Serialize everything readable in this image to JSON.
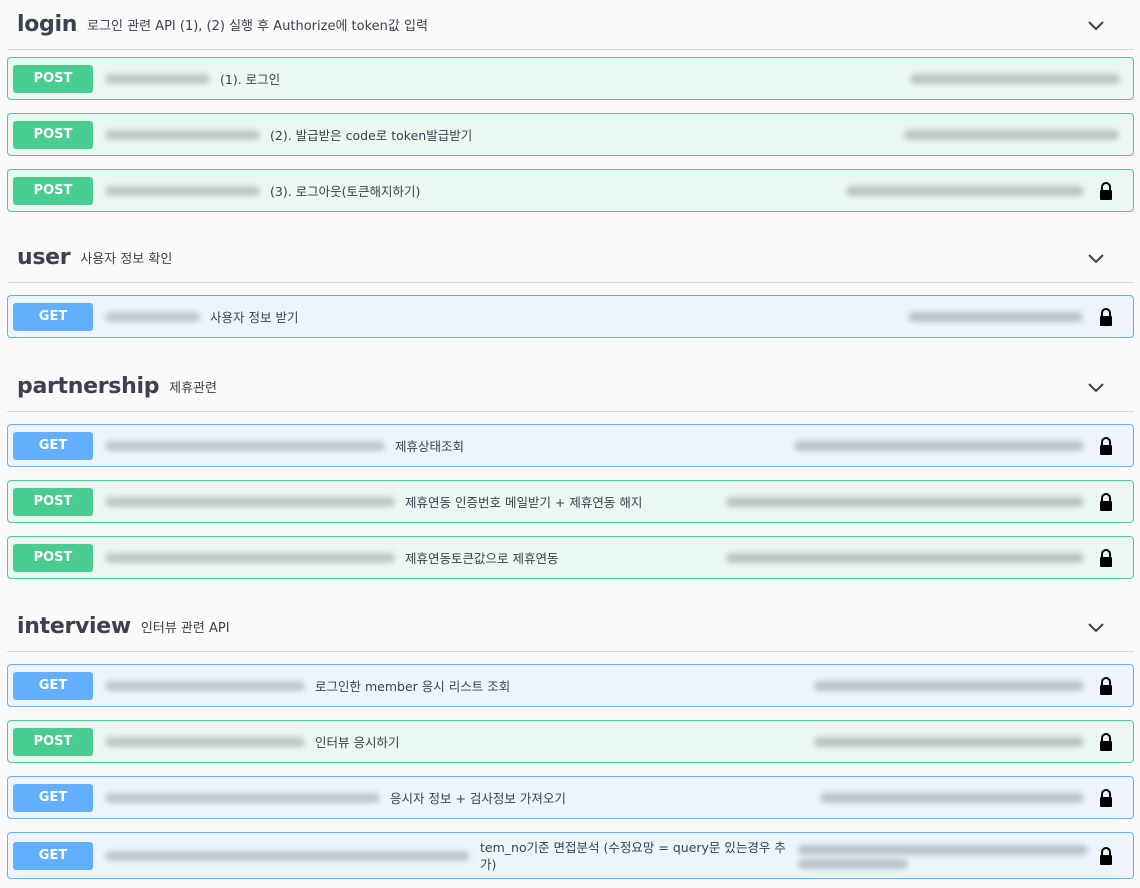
{
  "sections": [
    {
      "tag": "login",
      "description": "로그인 관련 API (1), (2) 실행 후 Authorize에 token값 입력",
      "operations": [
        {
          "method": "POST",
          "summary": "(1). 로그인",
          "locked": false
        },
        {
          "method": "POST",
          "summary": "(2). 발급받은 code로 token발급받기",
          "locked": false
        },
        {
          "method": "POST",
          "summary": "(3). 로그아웃(토큰해지하기)",
          "locked": true
        }
      ]
    },
    {
      "tag": "user",
      "description": "사용자 정보 확인",
      "operations": [
        {
          "method": "GET",
          "summary": "사용자 정보 받기",
          "locked": true
        }
      ]
    },
    {
      "tag": "partnership",
      "description": "제휴관련",
      "operations": [
        {
          "method": "GET",
          "summary": "제휴상태조회",
          "locked": true
        },
        {
          "method": "POST",
          "summary": "제휴연동 인증번호 메일받기 + 제휴연동 해지",
          "locked": true
        },
        {
          "method": "POST",
          "summary": "제휴연동토큰값으로 제휴연동",
          "locked": true
        }
      ]
    },
    {
      "tag": "interview",
      "description": "인터뷰 관련 API",
      "operations": [
        {
          "method": "GET",
          "summary": "로그인한 member 응시 리스트 조회",
          "locked": true
        },
        {
          "method": "POST",
          "summary": "인터뷰 응시하기",
          "locked": true
        },
        {
          "method": "GET",
          "summary": "응시자 정보 + 검사정보 가져오기",
          "locked": true
        },
        {
          "method": "GET",
          "summary": "tem_no기준 면접분석 (수정요망 = query문 있는경우 추가)",
          "locked": true
        }
      ]
    }
  ],
  "icons": {
    "chevron": "chevron-down-icon",
    "lock": "lock-icon"
  },
  "colors": {
    "post": "#49cc90",
    "get": "#61affe",
    "post_bg": "#ebf7f1",
    "get_bg": "#eef4fb"
  }
}
